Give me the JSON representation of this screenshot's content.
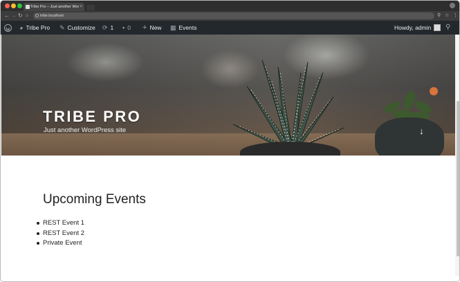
{
  "browser": {
    "tab_title": "Tribe Pro – Just another Wor",
    "tab_close": "×",
    "url": "tribe.localhost"
  },
  "adminbar": {
    "site_name": "Tribe Pro",
    "customize": "Customize",
    "updates_count": "1",
    "comments_count": "0",
    "new": "New",
    "events": "Events",
    "howdy": "Howdy, admin"
  },
  "hero": {
    "site_title": "TRIBE PRO",
    "site_description": "Just another WordPress site",
    "scroll_arrow": "↓"
  },
  "content": {
    "heading": "Upcoming Events",
    "events": [
      "REST Event 1",
      "REST Event 2",
      "Private Event"
    ]
  },
  "colors": {
    "adminbar_bg": "#23282d",
    "chrome_bg": "#2e2e2e"
  }
}
